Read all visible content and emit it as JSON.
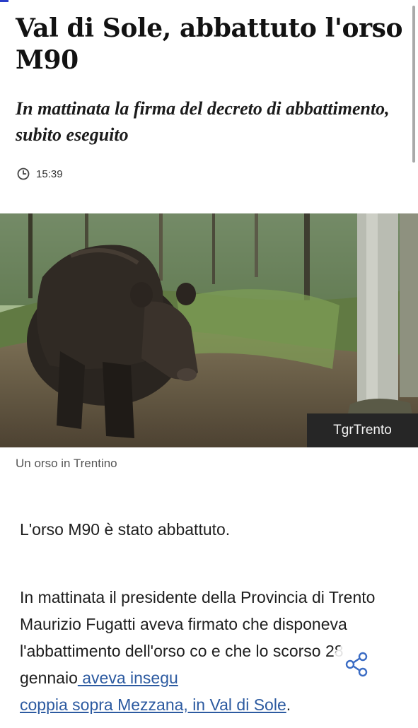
{
  "article": {
    "headline": "Val di Sole, abbattuto l'orso M90",
    "subtitle": "In mattinata la firma del decreto di abbattimento, subito eseguito",
    "time": "15:39"
  },
  "photo": {
    "credit": "TgrTrento",
    "caption": "Un orso in Trentino"
  },
  "body": {
    "paragraph1": "L'orso M90 è stato abbattuto.",
    "paragraph2_text": "In mattinata il presidente della Provincia di Trento Maurizio Fugatti aveva firmato che disponeva l'abbattimento dell'orso co",
    "paragraph2_text_b": "e che lo scorso 28 gennaio",
    "paragraph2_link": " aveva insegu",
    "paragraph2_link_b": "coppia sopra Mezzana, in Val di Sole",
    "paragraph2_end": "."
  },
  "icons": {
    "clock": "clock-icon",
    "share": "share-icon"
  },
  "colors": {
    "link": "#2c5aa0",
    "share_accent": "#3b6cc4",
    "credit_bg": "#262626",
    "top_accent": "#2a3ec8"
  }
}
